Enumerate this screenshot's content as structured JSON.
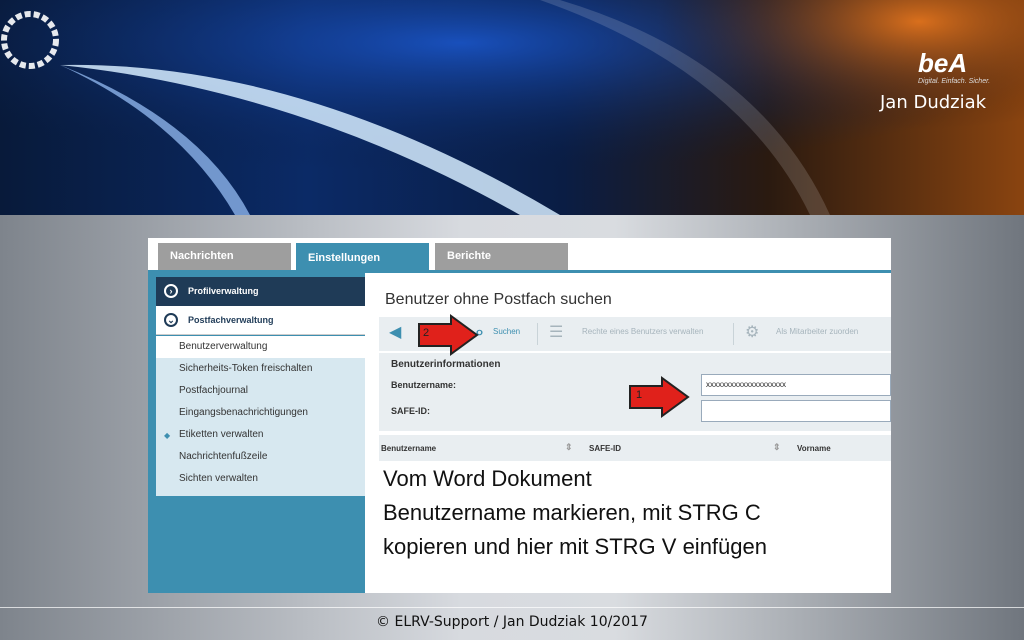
{
  "brand": {
    "logo_text": "beA",
    "logo_sub": "Digital. Einfach. Sicher.",
    "presenter": "Jan Dudziak"
  },
  "tabs": [
    {
      "label": "Nachrichten",
      "active": false
    },
    {
      "label": "Einstellungen",
      "active": true
    },
    {
      "label": "Berichte",
      "active": false
    }
  ],
  "sidebar": {
    "profil": "Profilverwaltung",
    "postfach": "Postfachverwaltung",
    "items": [
      {
        "label": "Benutzerverwaltung",
        "selected": true
      },
      {
        "label": "Sicherheits-Token freischalten"
      },
      {
        "label": "Postfachjournal"
      },
      {
        "label": "Eingangsbenachrichtigungen"
      },
      {
        "label": "Etiketten verwalten"
      },
      {
        "label": "Nachrichtenfußzeile"
      },
      {
        "label": "Sichten verwalten"
      }
    ]
  },
  "main": {
    "title": "Benutzer ohne Postfach suchen",
    "toolbar": {
      "search": "Suchen",
      "rights": "Rechte eines Benutzers verwalten",
      "assign": "Als Mitarbeiter zuorden"
    },
    "form": {
      "heading": "Benutzerinformationen",
      "username_label": "Benutzername:",
      "username_value": "xxxxxxxxxxxxxxxxxxxx",
      "safeid_label": "SAFE-ID:",
      "safeid_value": ""
    },
    "table_headers": [
      "Benutzername",
      "SAFE-ID",
      "Vorname"
    ]
  },
  "annotations": {
    "arrow1": "1",
    "arrow2": "2",
    "lines": [
      "Vom Word Dokument",
      "Benutzername markieren, mit STRG C",
      "kopieren und hier mit STRG V einfügen"
    ]
  },
  "footer": "© ELRV-Support / Jan Dudziak 10/2017",
  "colors": {
    "accent": "#3d8fb0",
    "nav_dark": "#1f3b57",
    "arrow": "#e0211b"
  }
}
